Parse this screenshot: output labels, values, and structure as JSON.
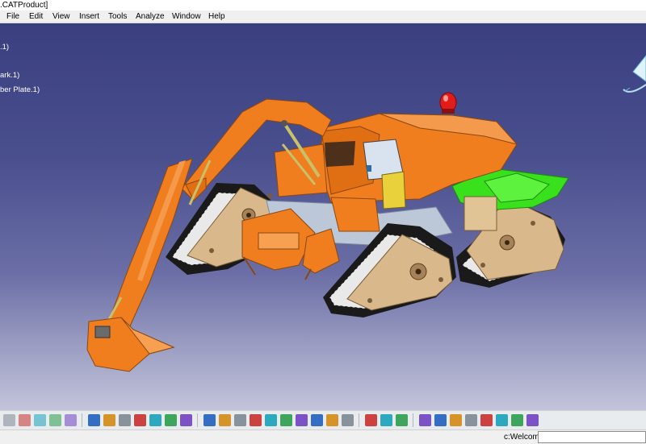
{
  "window": {
    "title": ".CATProduct]"
  },
  "menu": {
    "items": [
      {
        "label": "File",
        "name": "menu-file"
      },
      {
        "label": "Edit",
        "name": "menu-edit"
      },
      {
        "label": "View",
        "name": "menu-view"
      },
      {
        "label": "Insert",
        "name": "menu-insert"
      },
      {
        "label": "Tools",
        "name": "menu-tools"
      },
      {
        "label": "Analyze",
        "name": "menu-analyze"
      },
      {
        "label": "Window",
        "name": "menu-window"
      },
      {
        "label": "Help",
        "name": "menu-help"
      }
    ]
  },
  "tree": {
    "nodes": [
      ".1)",
      "ark.1)",
      "ber Plate.1)"
    ]
  },
  "toolbar": {
    "icons": [
      "new-icon",
      "open-icon",
      "undo-icon",
      "redo-icon",
      "whats-this-icon",
      "formula-icon",
      "knowledge-icon",
      "measure-icon",
      "table-icon",
      "graph-icon",
      "catalog-icon",
      "parts-icon",
      "fit-all-icon",
      "pan-icon",
      "rotate-icon",
      "zoom-in-icon",
      "zoom-out-icon",
      "normal-view-icon",
      "iso-view-icon",
      "render-style-icon",
      "hide-show-icon",
      "swap-icon",
      "constraint-icon",
      "snap-icon",
      "manipulate-icon",
      "compass-icon",
      "explode-icon",
      "clash-icon",
      "search-icon",
      "shading-icon",
      "apply-material-icon",
      "sectioning-icon",
      "properties-icon"
    ]
  },
  "status": {
    "message": "c:Welcome",
    "command_value": ""
  },
  "colors": {
    "viewport_top": "#3a3f80",
    "viewport_bottom": "#c3c4db",
    "body_orange": "#f07d1e",
    "track_tan": "#d9b98b",
    "accent_green": "#39e01c",
    "beacon_red": "#e21b1b"
  }
}
